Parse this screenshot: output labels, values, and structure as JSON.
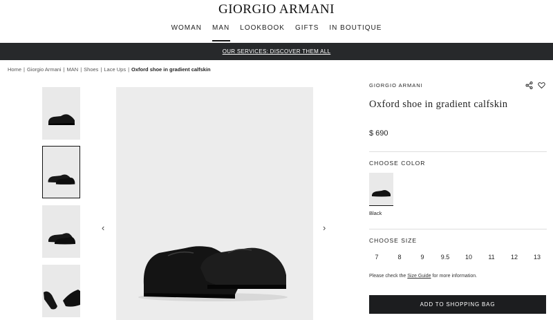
{
  "header": {
    "brand": "GIORGIO ARMANI",
    "nav": [
      "WOMAN",
      "MAN",
      "LOOKBOOK",
      "GIFTS",
      "IN BOUTIQUE"
    ],
    "active_nav": "MAN"
  },
  "banner": {
    "text": "OUR SERVICES: DISCOVER THEM ALL"
  },
  "breadcrumb": {
    "items": [
      "Home",
      "Giorgio Armani",
      "MAN",
      "Shoes",
      "Lace Ups"
    ],
    "separator": "|",
    "current": "Oxford shoe in gradient calfskin"
  },
  "gallery": {
    "thumbnail_count": 4,
    "selected_thumbnail": 2,
    "prev_icon": "chevron-left-icon",
    "next_icon": "chevron-right-icon"
  },
  "product": {
    "brand": "GIORGIO ARMANI",
    "title": "Oxford shoe in gradient calfskin",
    "price": "$ 690",
    "share_icon": "share-icon",
    "wishlist_icon": "heart-icon",
    "color_label": "CHOOSE COLOR",
    "selected_color": "Black",
    "size_label": "CHOOSE SIZE",
    "sizes": [
      "7",
      "8",
      "9",
      "9.5",
      "10",
      "11",
      "12",
      "13"
    ],
    "size_note_before": "Please check the",
    "size_guide_link": "Size Guide",
    "size_note_after": "for more information.",
    "add_button": "ADD TO SHOPPING BAG"
  },
  "colors": {
    "banner_bg": "#27292b",
    "button_bg": "#1c1d1f",
    "image_bg": "#ececec"
  }
}
